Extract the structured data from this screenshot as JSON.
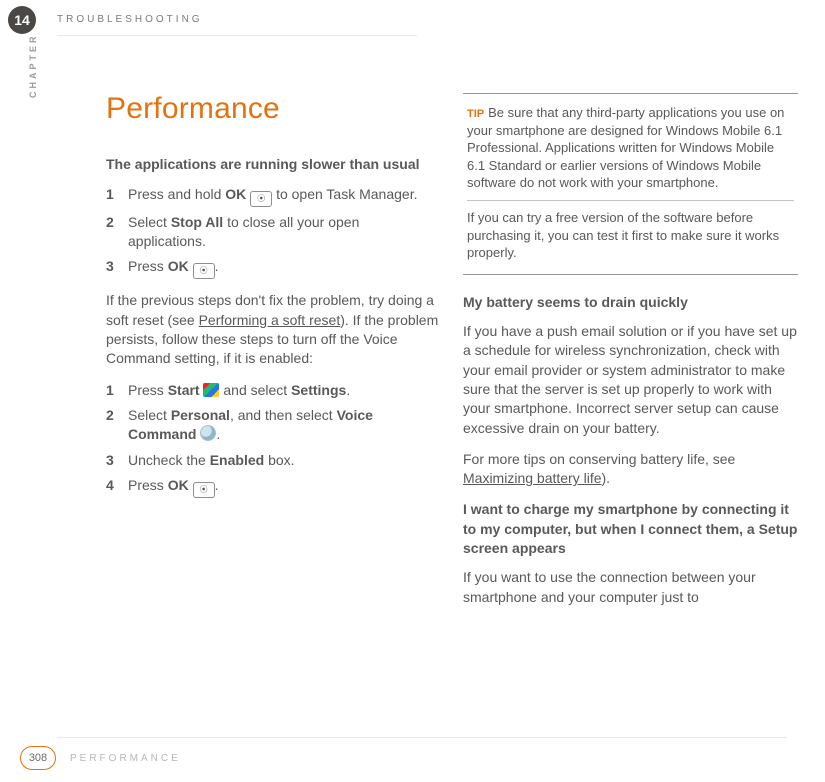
{
  "header": {
    "chapter_number": "14",
    "breadcrumb": "TROUBLESHOOTING",
    "chapter_word": "CHAPTER"
  },
  "left": {
    "title": "Performance",
    "h1": "The applications are running slower than usual",
    "stepsA": [
      {
        "n": "1",
        "pre": "Press and hold ",
        "b": "OK",
        "post": " to open Task Manager."
      },
      {
        "n": "2",
        "pre": "Select ",
        "b": "Stop All",
        "post": " to close all your open applications."
      },
      {
        "n": "3",
        "pre": "Press ",
        "b": "OK",
        "post": "."
      }
    ],
    "para_mid_pre": "If the previous steps don't fix the problem, try doing a soft reset (see ",
    "para_mid_link": "Performing a soft reset",
    "para_mid_post": "). If the problem persists, follow these steps to turn off the Voice Command setting, if it is enabled:",
    "stepsB": [
      {
        "n": "1",
        "pre": "Press ",
        "b1": "Start",
        "mid": " and select ",
        "b2": "Settings",
        "post": "."
      },
      {
        "n": "2",
        "pre": "Select ",
        "b1": "Personal",
        "mid": ", and then select ",
        "b2": "Voice Command",
        "post": "."
      },
      {
        "n": "3",
        "pre": "Uncheck the ",
        "b1": "Enabled",
        "post": " box."
      },
      {
        "n": "4",
        "pre": "Press ",
        "b1": "OK",
        "post": "."
      }
    ]
  },
  "right": {
    "tip_label": "TIP",
    "tip1": "Be sure that any third-party applications you use on your smartphone are designed for Windows Mobile 6.1 Professional. Applications written for Windows Mobile 6.1 Standard or earlier versions of Windows Mobile software do not work with your smartphone.",
    "tip2": "If you can try a free version of the software before purchasing it, you can test it first to make sure it works properly.",
    "h2": "My battery seems to drain quickly",
    "p2": "If you have a push email solution or if you have set up a schedule for wireless synchronization, check with your email provider or system administrator to make sure that the server is set up properly to work with your smartphone. Incorrect server setup can cause excessive drain on your battery.",
    "p3_pre": "For more tips on conserving battery life, see ",
    "p3_link": "Maximizing battery life",
    "p3_post": ").",
    "h3": "I want to charge my smartphone by connecting it to my computer, but when I connect them, a Setup screen appears",
    "p4": "If you want to use the connection between your smartphone and your computer just to"
  },
  "footer": {
    "page_number": "308",
    "label": "PERFORMANCE"
  },
  "icons": {
    "ok": "ok-button-icon",
    "start": "windows-start-icon",
    "voice": "voice-command-icon"
  }
}
